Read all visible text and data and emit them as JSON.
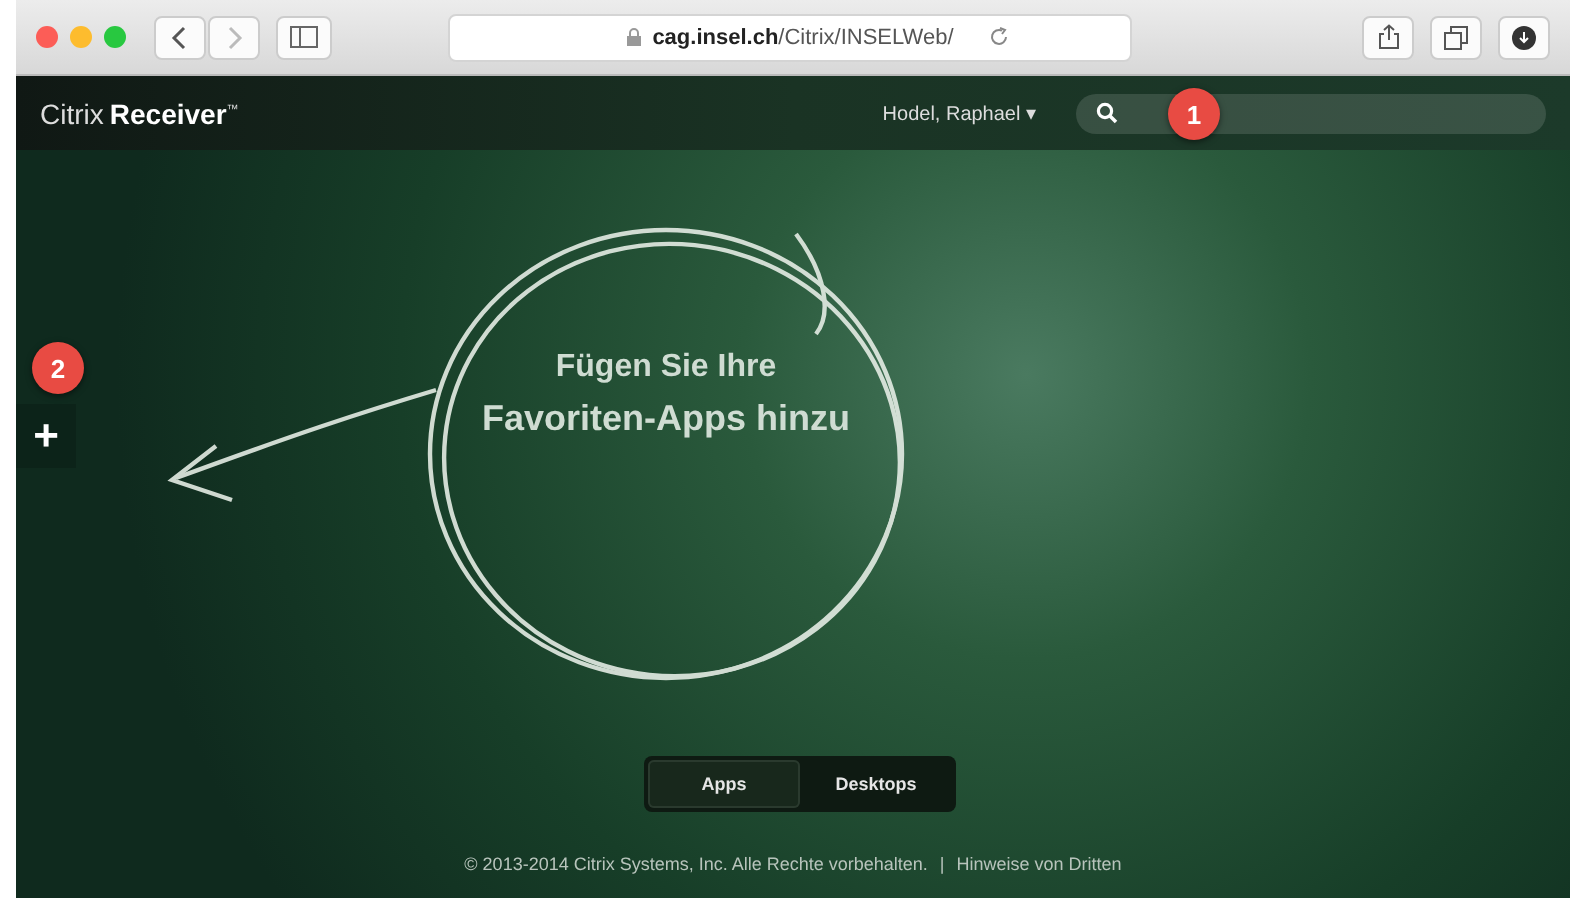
{
  "browser": {
    "url_host": "cag.insel.ch",
    "url_path": "/Citrix/INSELWeb/"
  },
  "header": {
    "logo_light": "Citrix",
    "logo_bold": "Receiver",
    "logo_mark": "™",
    "user": "Hodel, Raphael ▾",
    "callout": "1"
  },
  "sidebar": {
    "add": "+",
    "callout": "2"
  },
  "message": [
    "Fügen Sie Ihre",
    "Favoriten-Apps hinzu"
  ],
  "tabs": [
    {
      "label": "Apps",
      "selected": true
    },
    {
      "label": "Desktops",
      "selected": false
    }
  ],
  "footer": {
    "copyright": "© 2013-2014 Citrix Systems, Inc. Alle Rechte vorbehalten.",
    "separator": "|",
    "link": "Hinweise von Dritten"
  }
}
